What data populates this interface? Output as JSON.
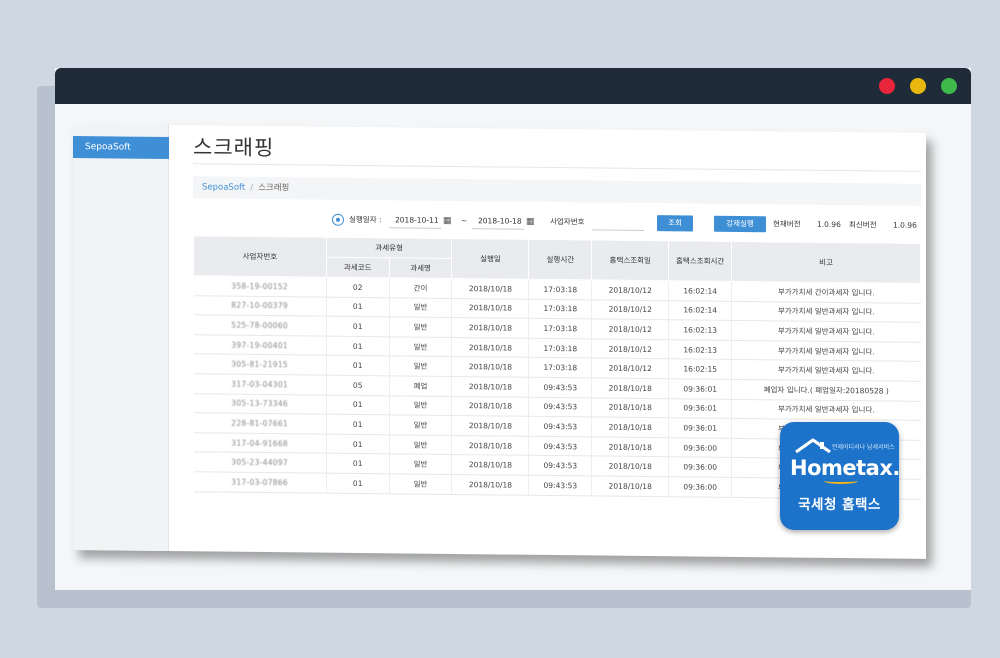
{
  "sidebar": {
    "items": [
      {
        "label": "SepoaSoft"
      }
    ]
  },
  "page": {
    "title": "스크래핑"
  },
  "breadcrumb": {
    "root": "SepoaSoft",
    "separator": "/",
    "current": "스크래핑"
  },
  "filter": {
    "exec_date_label": "실행일자 :",
    "date_from": "2018-10-11",
    "range_separator": "~",
    "date_to": "2018-10-18",
    "biz_no_label": "사업자번호",
    "biz_no_value": "",
    "search_button": "조회",
    "force_button": "강제실행",
    "current_version_label": "현재버전",
    "current_version": "1.0.96",
    "latest_version_label": "최신버전",
    "latest_version": "1.0.96",
    "calendar_icon": "calendar-icon"
  },
  "table": {
    "headers": {
      "biz_no": "사업자번호",
      "tax_type": "과세유형",
      "tax_code": "과세코드",
      "tax_name": "과세명",
      "exec_date": "실행일",
      "exec_time": "실행시간",
      "ht_date": "홈택스조회일",
      "ht_time": "홈택스조회시간",
      "note": "비고"
    },
    "rows": [
      {
        "biz_no": "358-19-00152",
        "code": "02",
        "name": "간이",
        "exec_date": "2018/10/18",
        "exec_time": "17:03:18",
        "ht_date": "2018/10/12",
        "ht_time": "16:02:14",
        "note": "부가가치세 간이과세자 입니다."
      },
      {
        "biz_no": "827-10-00379",
        "code": "01",
        "name": "일반",
        "exec_date": "2018/10/18",
        "exec_time": "17:03:18",
        "ht_date": "2018/10/12",
        "ht_time": "16:02:14",
        "note": "부가가치세 일반과세자 입니다."
      },
      {
        "biz_no": "525-78-00060",
        "code": "01",
        "name": "일반",
        "exec_date": "2018/10/18",
        "exec_time": "17:03:18",
        "ht_date": "2018/10/12",
        "ht_time": "16:02:13",
        "note": "부가가치세 일반과세자 입니다."
      },
      {
        "biz_no": "397-19-00401",
        "code": "01",
        "name": "일반",
        "exec_date": "2018/10/18",
        "exec_time": "17:03:18",
        "ht_date": "2018/10/12",
        "ht_time": "16:02:13",
        "note": "부가가치세 일반과세자 입니다."
      },
      {
        "biz_no": "305-81-21915",
        "code": "01",
        "name": "일반",
        "exec_date": "2018/10/18",
        "exec_time": "17:03:18",
        "ht_date": "2018/10/12",
        "ht_time": "16:02:15",
        "note": "부가가치세 일반과세자 입니다."
      },
      {
        "biz_no": "317-03-04301",
        "code": "05",
        "name": "폐업",
        "exec_date": "2018/10/18",
        "exec_time": "09:43:53",
        "ht_date": "2018/10/18",
        "ht_time": "09:36:01",
        "note": "폐업자 입니다.( 폐업일자:20180528 )"
      },
      {
        "biz_no": "305-13-73346",
        "code": "01",
        "name": "일반",
        "exec_date": "2018/10/18",
        "exec_time": "09:43:53",
        "ht_date": "2018/10/18",
        "ht_time": "09:36:01",
        "note": "부가가치세 일반과세자 입니다."
      },
      {
        "biz_no": "228-81-07661",
        "code": "01",
        "name": "일반",
        "exec_date": "2018/10/18",
        "exec_time": "09:43:53",
        "ht_date": "2018/10/18",
        "ht_time": "09:36:01",
        "note": "부가가치세 일반과세자 입니다."
      },
      {
        "biz_no": "317-04-91668",
        "code": "01",
        "name": "일반",
        "exec_date": "2018/10/18",
        "exec_time": "09:43:53",
        "ht_date": "2018/10/18",
        "ht_time": "09:36:00",
        "note": "부가가치세 일반과세자 입니다."
      },
      {
        "biz_no": "305-23-44097",
        "code": "01",
        "name": "일반",
        "exec_date": "2018/10/18",
        "exec_time": "09:43:53",
        "ht_date": "2018/10/18",
        "ht_time": "09:36:00",
        "note": "부가가치세 일반과세자 입니다."
      },
      {
        "biz_no": "317-03-07866",
        "code": "01",
        "name": "일반",
        "exec_date": "2018/10/18",
        "exec_time": "09:43:53",
        "ht_date": "2018/10/18",
        "ht_time": "09:36:00",
        "note": "부가가치세 일반과세자 입니다."
      }
    ]
  },
  "badge": {
    "tagline": "언제어디서나 납세서비스",
    "logo": "Hometax.",
    "subtitle": "국세청 홈택스",
    "icon": "house-roof-icon"
  },
  "colors": {
    "accent": "#3e8fd6",
    "titlebar": "#1f2b38",
    "badge": "#1c73c9",
    "swoosh": "#f4b41a",
    "light_red": "#e8253a",
    "light_yellow": "#e8b80e",
    "light_green": "#3fb94a"
  }
}
